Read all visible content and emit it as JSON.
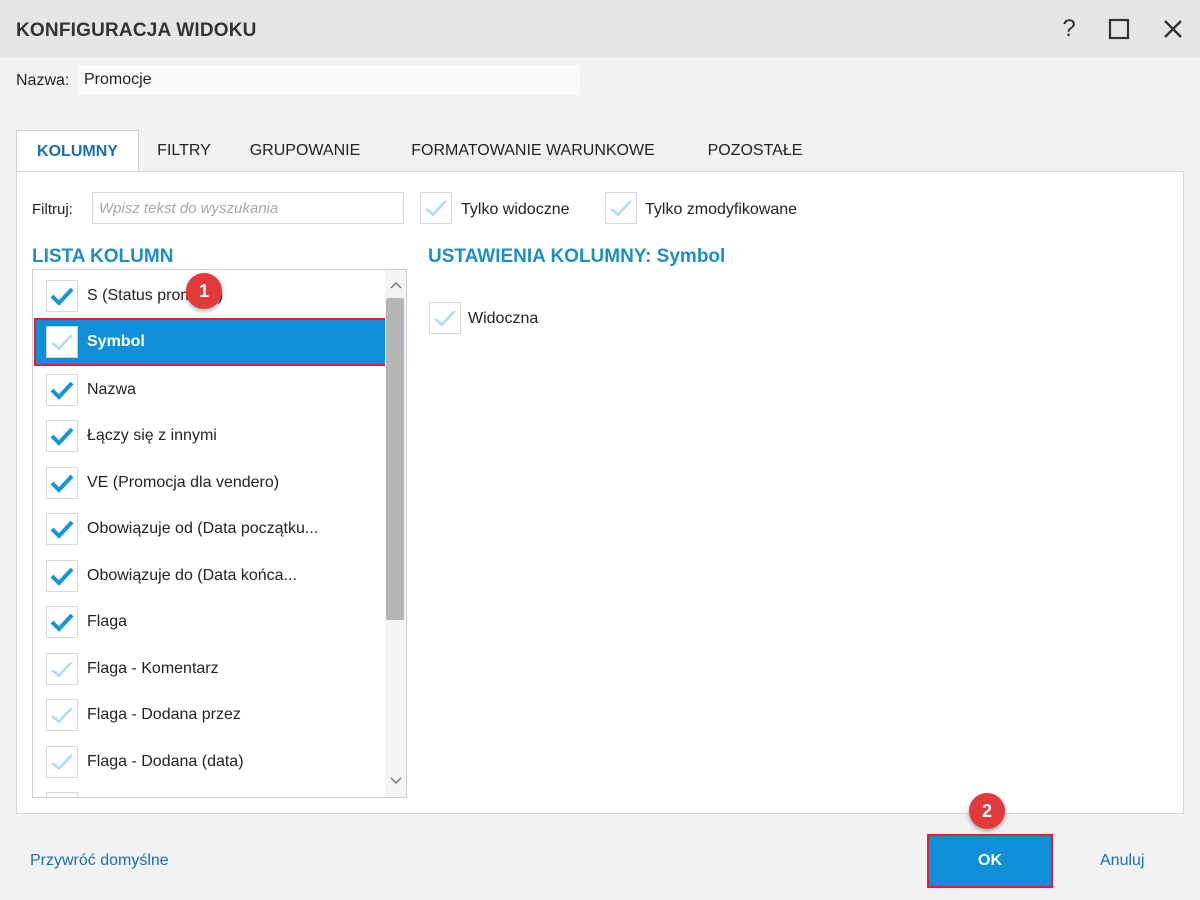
{
  "window": {
    "title": "KONFIGURACJA WIDOKU",
    "help_label": "?"
  },
  "name_field": {
    "label": "Nazwa:",
    "value": "Promocje"
  },
  "tabs": [
    {
      "label": "KOLUMNY",
      "active": true
    },
    {
      "label": "FILTRY",
      "active": false
    },
    {
      "label": "GRUPOWANIE",
      "active": false
    },
    {
      "label": "FORMATOWANIE WARUNKOWE",
      "active": false
    },
    {
      "label": "POZOSTAŁE",
      "active": false
    }
  ],
  "filter": {
    "label": "Filtruj:",
    "placeholder": "Wpisz tekst do wyszukania",
    "only_visible_label": "Tylko widoczne",
    "only_modified_label": "Tylko zmodyfikowane"
  },
  "column_list": {
    "title": "LISTA KOLUMN",
    "items": [
      {
        "label": "S (Status promocji)",
        "checked": true
      },
      {
        "label": "Symbol",
        "checked": false,
        "selected": true
      },
      {
        "label": "Nazwa",
        "checked": true
      },
      {
        "label": "Łączy się z innymi",
        "checked": true
      },
      {
        "label": "VE (Promocja dla vendero)",
        "checked": true
      },
      {
        "label": "Obowiązuje od (Data początku...",
        "checked": true
      },
      {
        "label": "Obowiązuje do (Data końca...",
        "checked": true
      },
      {
        "label": "Flaga",
        "checked": true
      },
      {
        "label": "Flaga - Komentarz",
        "checked": false
      },
      {
        "label": "Flaga - Dodana przez",
        "checked": false
      },
      {
        "label": "Flaga - Dodana (data)",
        "checked": false
      }
    ]
  },
  "column_settings": {
    "title": "USTAWIENIA KOLUMNY: Symbol",
    "visible_label": "Widoczna"
  },
  "badges": {
    "one": "1",
    "two": "2"
  },
  "footer": {
    "restore_label": "Przywróć domyślne",
    "ok_label": "OK",
    "cancel_label": "Anuluj"
  },
  "colors": {
    "accent": "#0f8fd8",
    "section_title": "#1e8fc4",
    "highlight": "#e0202e",
    "badge": "#e23a3a",
    "link": "#1a6fb0"
  },
  "icons": {
    "check_on": "check-icon",
    "check_off": "check-outline-icon"
  }
}
